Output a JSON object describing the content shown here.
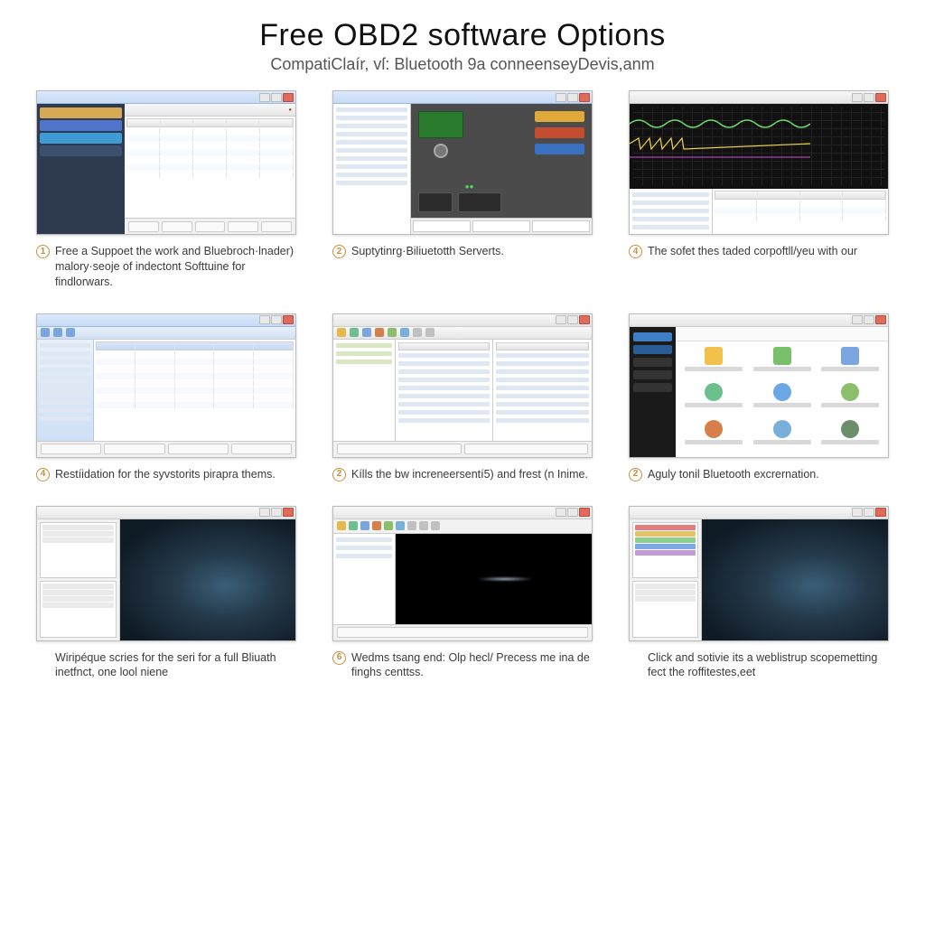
{
  "header": {
    "title": "Free OBD2 software Options",
    "subtitle": "CompatiClaír, vſ: Bluetooth 9a conneenseyDevis,anm"
  },
  "cells": [
    {
      "num": "1",
      "caption": "Free a Suppoet the work and Bluebroch·lnader) malory·seoje of indectont Softtuine for findlorwars."
    },
    {
      "num": "2",
      "caption": "Suptytinrg·Biliuetotth Serverts."
    },
    {
      "num": "4",
      "caption": "The sofet thes taded corpoftll/yeu with our"
    },
    {
      "num": "4",
      "caption": "Restíidation for the syvstorits pirapra thems."
    },
    {
      "num": "2",
      "caption": "Kílls the bw increneersentí5) and frest (n Inime."
    },
    {
      "num": "2",
      "caption": "Aguly tonil Bluetooth excrernation."
    },
    {
      "num": "",
      "caption": "Wiripéque scries for the seri for a full Bliuath inetfnct, one lool niene"
    },
    {
      "num": "6",
      "caption": "Wedms tsang end: Olp hecl/ Precess me ina de finghs centtss."
    },
    {
      "num": "",
      "caption": "Click and sotivie its a weblistrup scopemetting fect the roffitestes,eet"
    }
  ],
  "icon_colors": [
    "#f1c14b",
    "#79c06a",
    "#7aa6e0",
    "#6cc08b",
    "#6aa8e6",
    "#8bbf6b",
    "#d77f4a",
    "#78b0d9",
    "#6a8f6a"
  ]
}
